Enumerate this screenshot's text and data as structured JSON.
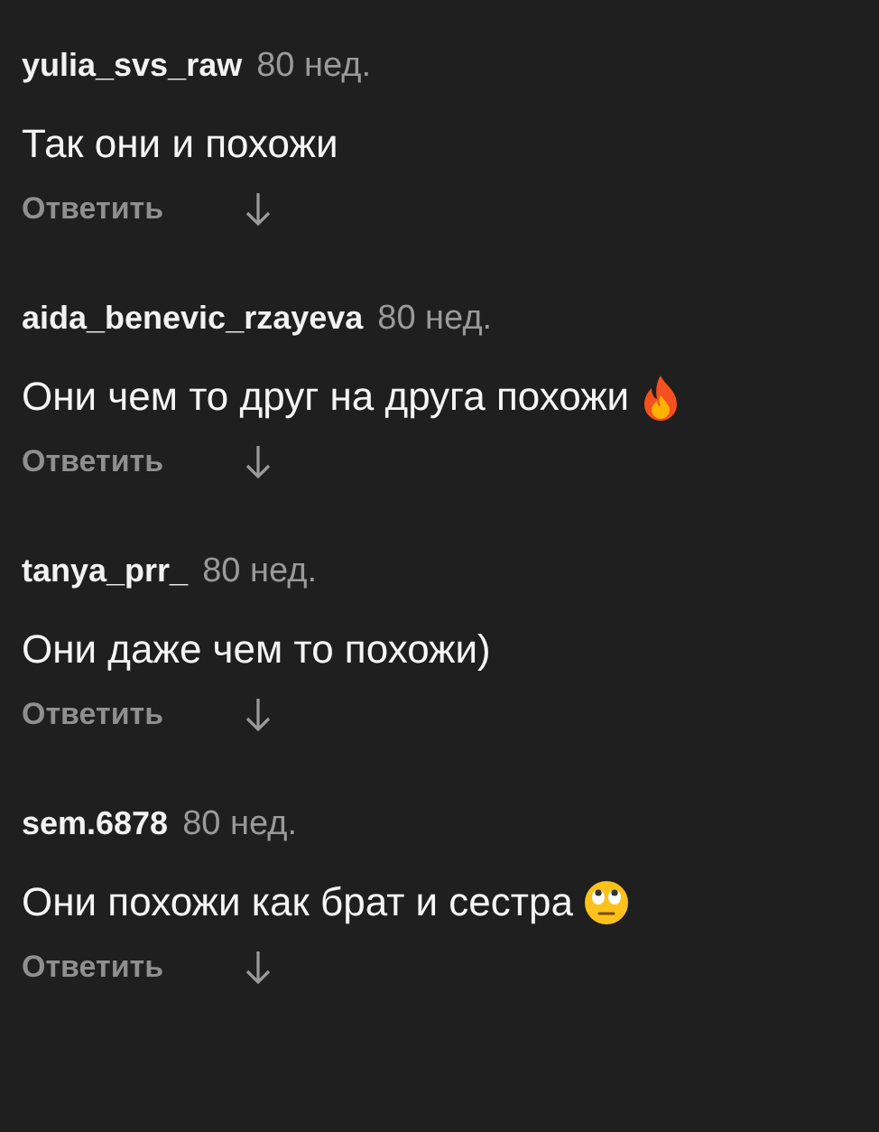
{
  "comments": [
    {
      "kind": "plain",
      "username": "yulia_svs_raw",
      "time": "80 нед.",
      "text": "Так они и похожи",
      "reply": "Ответить"
    },
    {
      "kind": "fire",
      "username": "aida_benevic_rzayeva",
      "time": "80 нед.",
      "text": "Они чем то друг на друга похожи",
      "reply": "Ответить"
    },
    {
      "kind": "plain",
      "username": "tanya_prr_",
      "time": "80 нед.",
      "text": "Они даже чем то похожи)",
      "reply": "Ответить"
    },
    {
      "kind": "eyeroll",
      "username": "sem.6878",
      "time": "80 нед.",
      "text": "Они похожи как брат и сестра",
      "reply": "Ответить"
    }
  ]
}
